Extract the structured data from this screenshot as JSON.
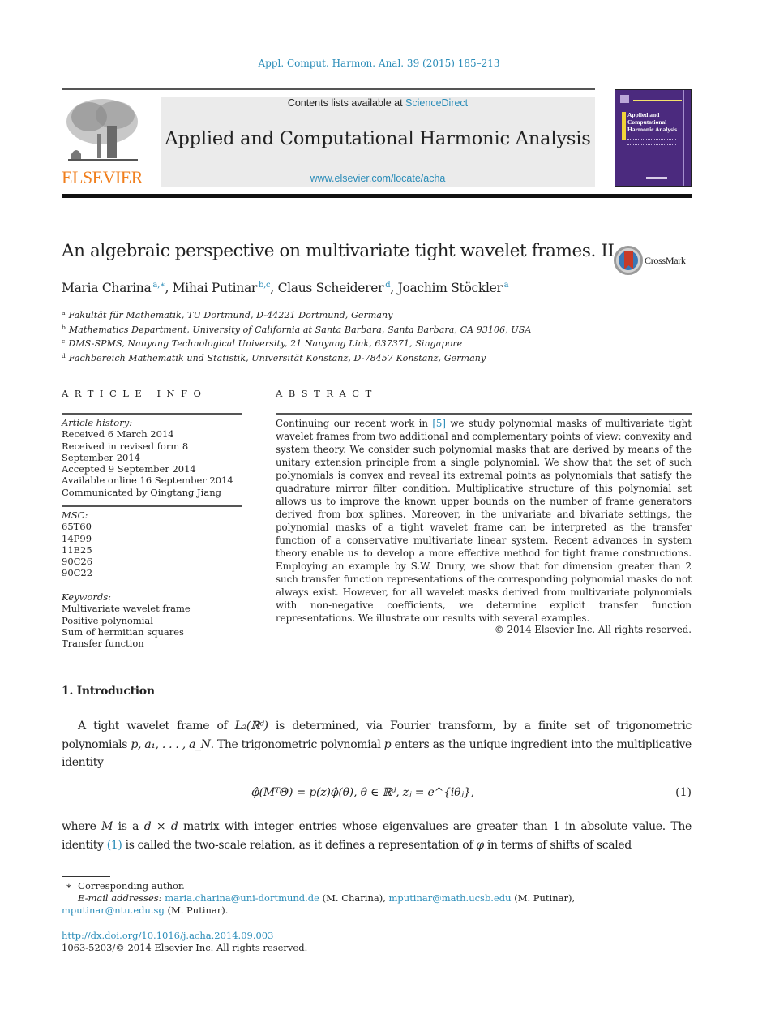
{
  "citation": "Appl. Comput. Harmon. Anal. 39 (2015) 185–213",
  "header": {
    "publisher_logo_text": "ELSEVIER",
    "contents_prefix": "Contents lists available at ",
    "contents_link": "ScienceDirect",
    "journal_name": "Applied and Computational Harmonic Analysis",
    "journal_url": "www.elsevier.com/locate/acha",
    "cover_title": [
      "Applied and",
      "Computational",
      "Harmonic Analysis"
    ],
    "colors": {
      "link": "#2a8cb8",
      "elsevier_orange": "#f07f1e",
      "cover_purple": "#4b2a7e",
      "banner_gray": "#ebebeb"
    }
  },
  "article": {
    "title": "An algebraic perspective on multivariate tight wavelet frames. II",
    "crossmark_label": "CrossMark",
    "authors": [
      {
        "name": "Maria Charina",
        "sup": "a,∗"
      },
      {
        "name": "Mihai Putinar",
        "sup": "b,c"
      },
      {
        "name": "Claus Scheiderer",
        "sup": "d"
      },
      {
        "name": "Joachim Stöckler",
        "sup": "a"
      }
    ],
    "affiliations": [
      {
        "key": "a",
        "text": "Fakultät für Mathematik, TU Dortmund, D-44221 Dortmund, Germany"
      },
      {
        "key": "b",
        "text": "Mathematics Department, University of California at Santa Barbara, Santa Barbara, CA 93106, USA"
      },
      {
        "key": "c",
        "text": "DMS-SPMS, Nanyang Technological University, 21 Nanyang Link, 637371, Singapore"
      },
      {
        "key": "d",
        "text": "Fachbereich Mathematik und Statistik, Universität Konstanz, D-78457 Konstanz, Germany"
      }
    ]
  },
  "article_info": {
    "heading": "ARTICLE INFO",
    "history_label": "Article history:",
    "history": [
      "Received 6 March 2014",
      "Received in revised form 8",
      "September 2014",
      "Accepted 9 September 2014",
      "Available online 16 September 2014",
      "Communicated by Qingtang Jiang"
    ],
    "msc_label": "MSC:",
    "msc": [
      "65T60",
      "14P99",
      "11E25",
      "90C26",
      "90C22"
    ],
    "keywords_label": "Keywords:",
    "keywords": [
      "Multivariate wavelet frame",
      "Positive polynomial",
      "Sum of hermitian squares",
      "Transfer function"
    ]
  },
  "abstract": {
    "heading": "ABSTRACT",
    "text_before_ref": "Continuing our recent work in ",
    "ref": "[5]",
    "text_after_ref": " we study polynomial masks of multivariate tight wavelet frames from two additional and complementary points of view: convexity and system theory. We consider such polynomial masks that are derived by means of the unitary extension principle from a single polynomial. We show that the set of such polynomials is convex and reveal its extremal points as polynomials that satisfy the quadrature mirror filter condition. Multiplicative structure of this polynomial set allows us to improve the known upper bounds on the number of frame generators derived from box splines. Moreover, in the univariate and bivariate settings, the polynomial masks of a tight wavelet frame can be interpreted as the transfer function of a conservative multivariate linear system. Recent advances in system theory enable us to develop a more effective method for tight frame constructions. Employing an example by S.W. Drury, we show that for dimension greater than 2 such transfer function representations of the corresponding polynomial masks do not always exist. However, for all wavelet masks derived from multivariate polynomials with non-negative coefficients, we determine explicit transfer function representations. We illustrate our results with several examples.",
    "copyright": "© 2014 Elsevier Inc. All rights reserved."
  },
  "body": {
    "section_heading": "1.  Introduction",
    "intro": {
      "t1": "A tight wavelet frame of ",
      "m1": "L₂(ℝᵈ)",
      "t2": " is determined, via Fourier transform, by a finite set of trigonometric polynomials ",
      "m2": "p, a₁, . . . , a_N",
      "t3": ". The trigonometric polynomial ",
      "m3": "p",
      "t4": " enters as the unique ingredient into the multiplicative identity"
    },
    "equation": {
      "body": "φ̂(MᵀΘ) = p(z)φ̂(θ),    θ ∈ ℝᵈ,  zⱼ = e^{iθⱼ},",
      "number": "(1)"
    },
    "after_eq": {
      "t1": "where ",
      "m1": "M",
      "t2": " is a ",
      "m2": "d × d",
      "t3": " matrix with integer entries whose eigenvalues are greater than 1 in absolute value. The identity ",
      "ref": "(1)",
      "t4": " is called the two-scale relation, as it defines a representation of ",
      "m3": "φ",
      "t5": " in terms of shifts of scaled"
    }
  },
  "footnotes": {
    "corresponding_mark": "∗",
    "corresponding_text": "Corresponding author.",
    "email_label": "E-mail addresses:",
    "emails": [
      {
        "addr": "maria.charina@uni-dortmund.de",
        "who": " (M. Charina), "
      },
      {
        "addr": "mputinar@math.ucsb.edu",
        "who": " (M. Putinar),"
      },
      {
        "addr": "mputinar@ntu.edu.sg",
        "who": " (M. Putinar)."
      }
    ],
    "doi": "http://dx.doi.org/10.1016/j.acha.2014.09.003",
    "issn_line": "1063-5203/© 2014 Elsevier Inc. All rights reserved."
  }
}
